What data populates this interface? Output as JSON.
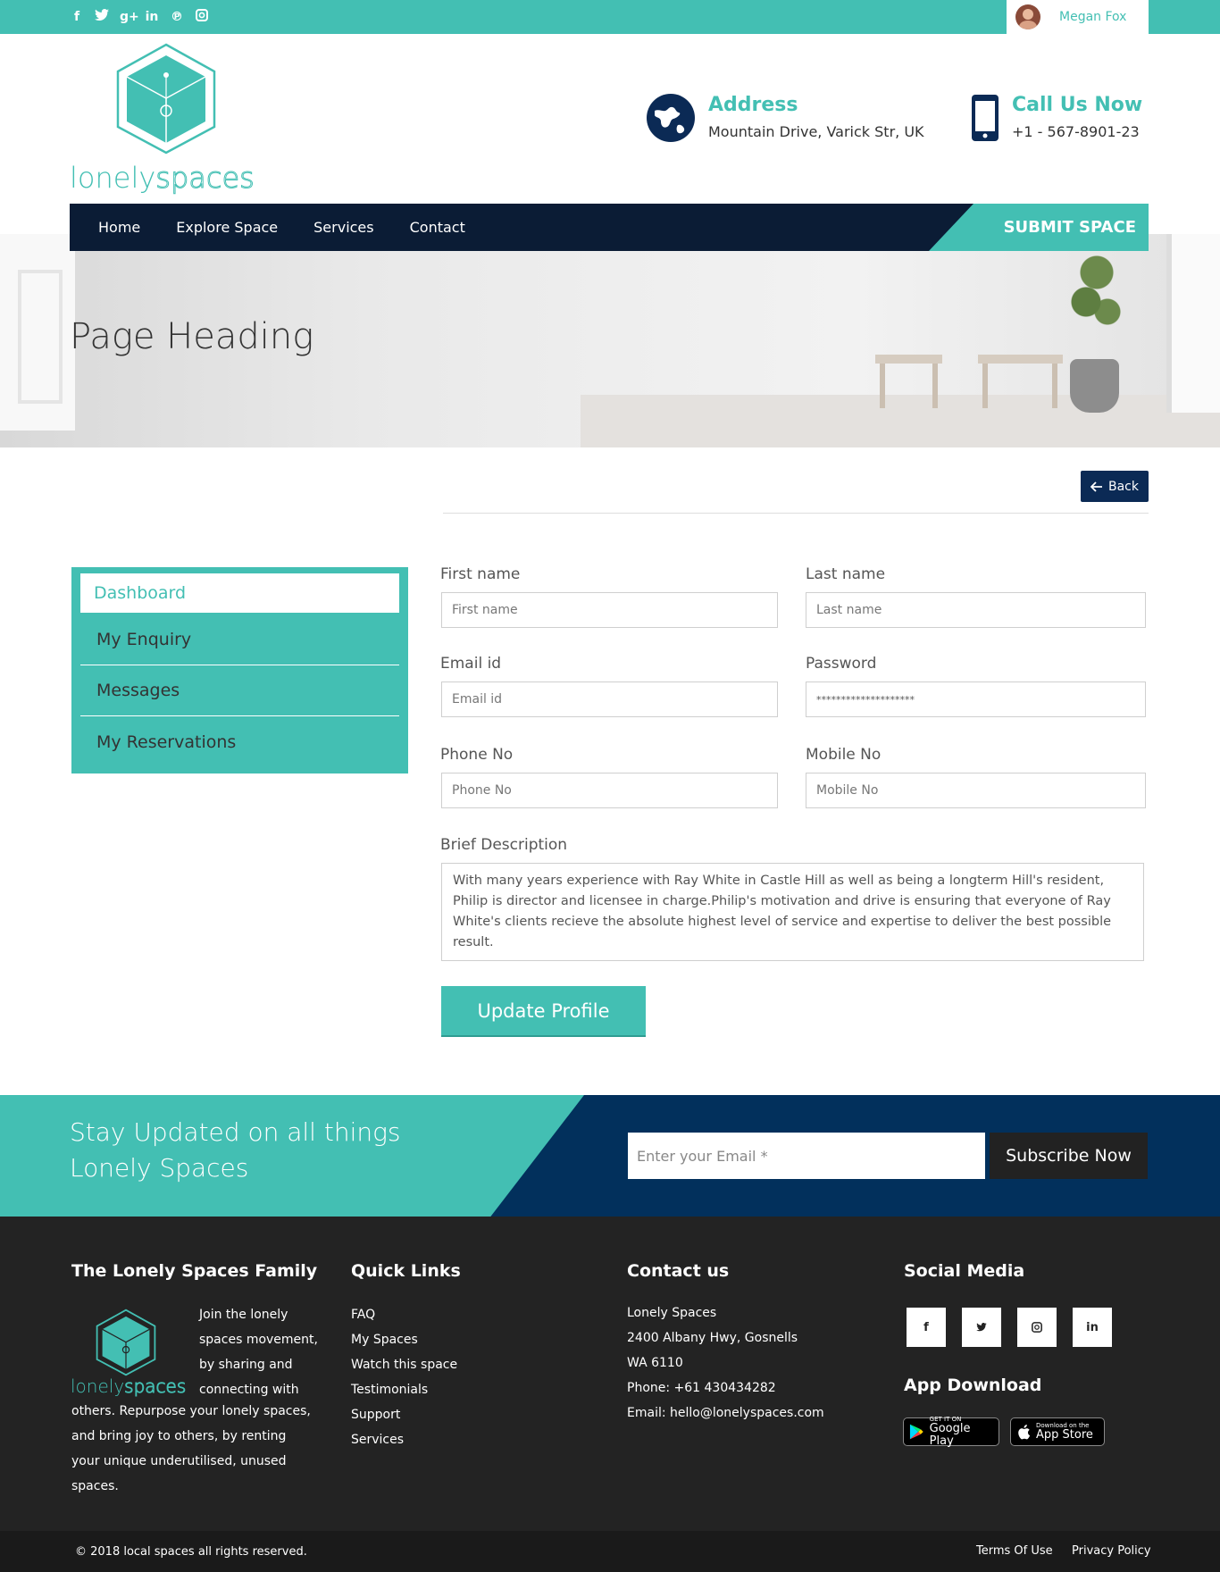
{
  "topbar": {
    "social_icons": [
      "facebook-icon",
      "twitter-icon",
      "google-plus-icon",
      "linkedin-icon",
      "pinterest-icon",
      "instagram-icon"
    ],
    "user_name": "Megan Fox"
  },
  "logo": {
    "part1": "lonely",
    "part2": "spaces"
  },
  "header": {
    "address_title": "Address",
    "address_value": "Mountain Drive, Varick Str, UK",
    "call_title": "Call Us Now",
    "call_value": "+1 - 567-8901-23"
  },
  "nav": {
    "items": [
      "Home",
      "Explore Space",
      "Services",
      "Contact"
    ],
    "submit_label": "SUBMIT SPACE"
  },
  "hero": {
    "heading": "Page Heading"
  },
  "back_label": "Back",
  "sidebar": {
    "items": [
      "Dashboard",
      "My Enquiry",
      "Messages",
      "My Reservations"
    ],
    "active": "Dashboard"
  },
  "form": {
    "first_name_label": "First name",
    "first_name_placeholder": "First name",
    "last_name_label": "Last name",
    "last_name_placeholder": "Last name",
    "email_label": "Email id",
    "email_placeholder": "Email id",
    "password_label": "Password",
    "password_value": "********************",
    "phone_label": "Phone No",
    "phone_placeholder": "Phone No",
    "mobile_label": "Mobile No",
    "mobile_placeholder": "Mobile No",
    "description_label": "Brief Description",
    "description_value": "With many years experience with Ray White in Castle Hill as well as being a longterm Hill's resident, Philip is director and licensee in charge.Philip's motivation and drive is ensuring that everyone of Ray White's clients recieve the absolute highest level of service and expertise to deliver the best possible result.",
    "submit_label": "Update Profile"
  },
  "newsletter": {
    "line1": "Stay Updated on all things",
    "line2": "Lonely Spaces",
    "email_placeholder": "Enter your Email *",
    "button_label": "Subscribe Now"
  },
  "footer": {
    "family_title": "The Lonely Spaces Family",
    "family_text_short": [
      "Join the lonely",
      "spaces movement,",
      "by sharing and",
      "connecting with"
    ],
    "family_text_long": [
      "others. Repurpose your lonely spaces,",
      "and bring joy to others, by renting",
      "your unique underutilised, unused",
      "spaces."
    ],
    "quick_title": "Quick Links",
    "quick_links": [
      "FAQ",
      "My Spaces",
      "Watch this space",
      "Testimonials",
      "Support",
      "Services"
    ],
    "contact_title": "Contact us",
    "contact_lines": [
      "Lonely Spaces",
      "2400 Albany Hwy, Gosnells",
      "WA 6110",
      "Phone: +61 430434282",
      "Email: hello@lonelyspaces.com"
    ],
    "social_title": "Social Media",
    "social_icons": [
      "f",
      "t",
      "ig",
      "in"
    ],
    "app_title": "App Download",
    "google_small": "GET IT ON",
    "google_big": "Google Play",
    "apple_small": "Download on the",
    "apple_big": "App Store"
  },
  "bottom": {
    "copyright": "© 2018 local spaces all rights reserved.",
    "terms": "Terms Of Use",
    "privacy": "Privacy Policy"
  },
  "colors": {
    "teal": "#43bfb3",
    "navy": "#0b1c35",
    "dark_blue": "#02305c",
    "footer_bg": "#232323"
  }
}
